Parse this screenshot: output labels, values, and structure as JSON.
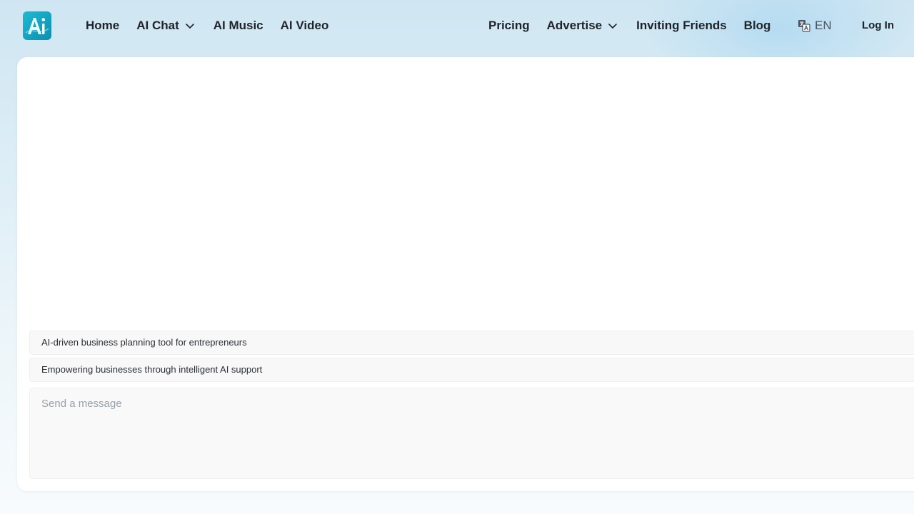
{
  "header": {
    "logo_text": "Ai",
    "nav_left": [
      {
        "label": "Home",
        "has_dropdown": false
      },
      {
        "label": "AI Chat",
        "has_dropdown": true
      },
      {
        "label": "AI Music",
        "has_dropdown": false
      },
      {
        "label": "AI Video",
        "has_dropdown": false
      }
    ],
    "nav_right": [
      {
        "label": "Pricing",
        "has_dropdown": false
      },
      {
        "label": "Advertise",
        "has_dropdown": true
      },
      {
        "label": "Inviting Friends",
        "has_dropdown": false
      },
      {
        "label": "Blog",
        "has_dropdown": false
      }
    ],
    "language": "EN",
    "login_label": "Log In"
  },
  "chat": {
    "suggestions": [
      "AI-driven business planning tool for entrepreneurs",
      "Empowering businesses through intelligent AI support"
    ],
    "input_placeholder": "Send a message",
    "input_value": ""
  },
  "colors": {
    "accent": "#12a6c4",
    "text": "#1f2329",
    "placeholder": "#9aa0a8"
  }
}
